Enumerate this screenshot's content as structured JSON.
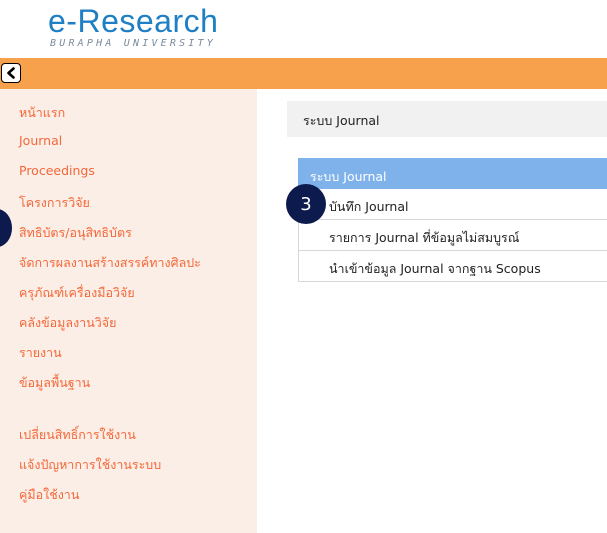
{
  "logo": {
    "title": "e-Research",
    "subtitle": "BURAPHA UNIVERSITY"
  },
  "topbar": {
    "back_icon": "chevron-left-icon"
  },
  "sidebar": {
    "items": [
      {
        "label": "หน้าแรก"
      },
      {
        "label": "Journal"
      },
      {
        "label": "Proceedings"
      },
      {
        "label": "โครงการวิจัย"
      },
      {
        "label": "สิทธิบัตร/อนุสิทธิบัตร"
      },
      {
        "label": "จัดการผลงานสร้างสรรค์ทางศิลปะ"
      },
      {
        "label": "ครุภัณฑ์เครื่องมือวิจัย"
      },
      {
        "label": "คลังข้อมูลงานวิจัย"
      },
      {
        "label": "รายงาน"
      },
      {
        "label": "ข้อมูลพื้นฐาน"
      },
      {
        "label": "เปลี่ยนสิทธิ์การใช้งาน"
      },
      {
        "label": "แจ้งปัญหาการใช้งานระบบ"
      },
      {
        "label": "คู่มือใช้งาน"
      }
    ]
  },
  "main": {
    "header_title": "ระบบ Journal",
    "list_title": "ระบบ Journal",
    "list_items": [
      {
        "label": "บันทึก Journal"
      },
      {
        "label": "รายการ Journal ที่ข้อมูลไม่สมบูรณ์"
      },
      {
        "label": "นำเข้าข้อมูล Journal จากฐาน Scopus"
      }
    ],
    "step_marker": "3"
  },
  "colors": {
    "accent_orange": "#f7a14d",
    "menu_text": "#f4683a",
    "list_header": "#7fb2ea",
    "marker": "#0c1a4e"
  }
}
